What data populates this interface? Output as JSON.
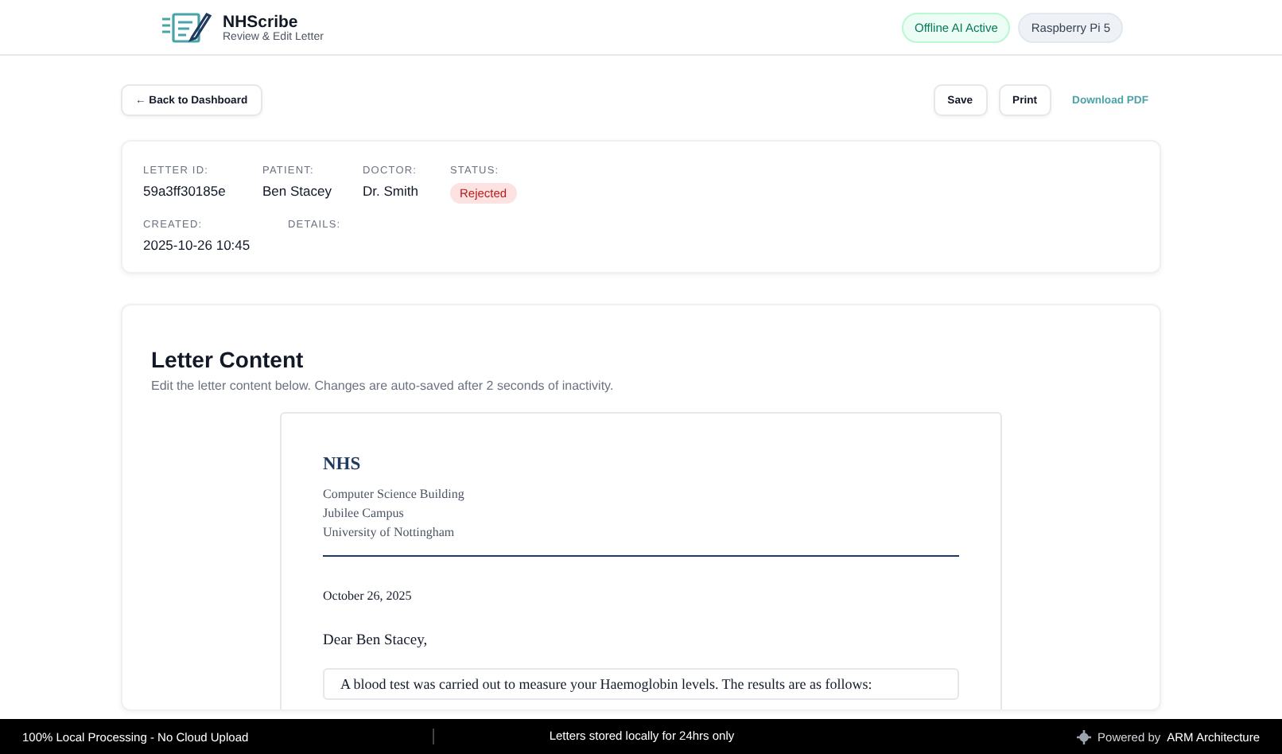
{
  "header": {
    "app_name": "NHScribe",
    "subtitle": "Review & Edit Letter",
    "badges": [
      {
        "label": "Offline AI Active",
        "kind": "status"
      },
      {
        "label": "Raspberry Pi 5",
        "kind": "device"
      }
    ]
  },
  "toolbar": {
    "back": "← Back to Dashboard",
    "buttons": [
      {
        "label": "Save",
        "kind": "outline"
      },
      {
        "label": "Print",
        "kind": "outline"
      },
      {
        "label": "Download PDF",
        "kind": "link"
      }
    ]
  },
  "meta": {
    "fields": [
      {
        "label": "LETTER ID:",
        "value": "59a3ff30185e",
        "kind": "text"
      },
      {
        "label": "PATIENT:",
        "value": "Ben Stacey",
        "kind": "text"
      },
      {
        "label": "DOCTOR:",
        "value": "Dr. Smith",
        "kind": "text"
      },
      {
        "label": "STATUS:",
        "value": "Rejected",
        "kind": "status"
      }
    ],
    "fields_2": [
      {
        "label": "CREATED:",
        "value": "2025-10-26 10:45",
        "kind": "text"
      },
      {
        "label": "DETAILS:",
        "kind": "empty"
      }
    ]
  },
  "letter": {
    "title": "Letter Content",
    "hint": "Edit the letter content below. Changes are auto-saved after 2 seconds of inactivity.",
    "org": "NHS",
    "address": [
      "Computer Science Building",
      "Jubilee Campus",
      "University of Nottingham"
    ],
    "date": "October 26, 2025",
    "greeting": "Dear Ben Stacey,",
    "body": "A blood test was carried out to measure your Haemoglobin levels. The results are as follows:"
  },
  "footer": {
    "left": "100% Local Processing - No Cloud Upload",
    "center": "Letters stored locally for 24hrs only",
    "right_prefix": "Powered by",
    "right_brand": "ARM Architecture"
  }
}
